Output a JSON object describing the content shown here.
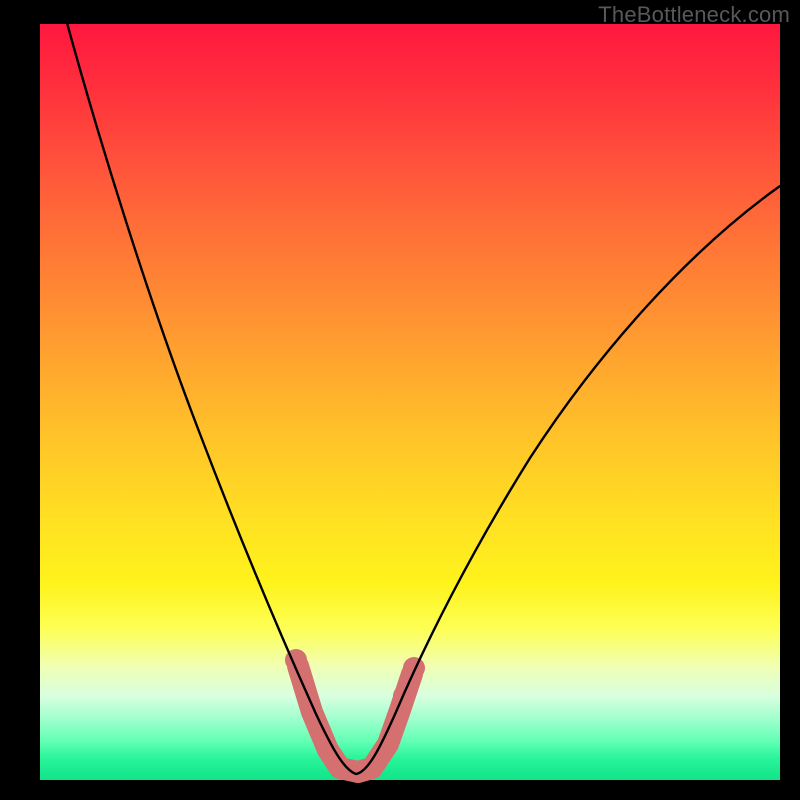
{
  "watermark": "TheBottleneck.com",
  "colors": {
    "curve": "#000000",
    "marker": "#d47070",
    "frame": "#000000"
  },
  "chart_data": {
    "type": "line",
    "title": "",
    "xlabel": "",
    "ylabel": "",
    "xlim": [
      0,
      100
    ],
    "ylim": [
      0,
      100
    ],
    "grid": false,
    "legend": false,
    "series": [
      {
        "name": "bottleneck-curve",
        "x": [
          4,
          8,
          12,
          16,
          20,
          24,
          27,
          30,
          33,
          35,
          37,
          39,
          40,
          41,
          42,
          43,
          45,
          47,
          50,
          54,
          58,
          63,
          68,
          74,
          80,
          86,
          92,
          98
        ],
        "y": [
          100,
          91,
          82,
          73,
          64,
          55,
          46,
          38,
          30,
          23,
          16,
          10,
          6,
          3,
          1,
          1,
          3,
          7,
          13,
          21,
          29,
          37,
          45,
          53,
          61,
          68,
          74,
          79
        ]
      }
    ],
    "markers": {
      "name": "highlight-band",
      "x": [
        36,
        38,
        40,
        42,
        44,
        46,
        48
      ],
      "y": [
        14,
        7,
        2,
        1,
        2,
        6,
        11
      ]
    },
    "background_gradient": [
      {
        "pos": 0,
        "color": "#ff173f"
      },
      {
        "pos": 36,
        "color": "#ff8a33"
      },
      {
        "pos": 66,
        "color": "#ffe122"
      },
      {
        "pos": 85,
        "color": "#f0ffb4"
      },
      {
        "pos": 100,
        "color": "#13e48a"
      }
    ]
  }
}
